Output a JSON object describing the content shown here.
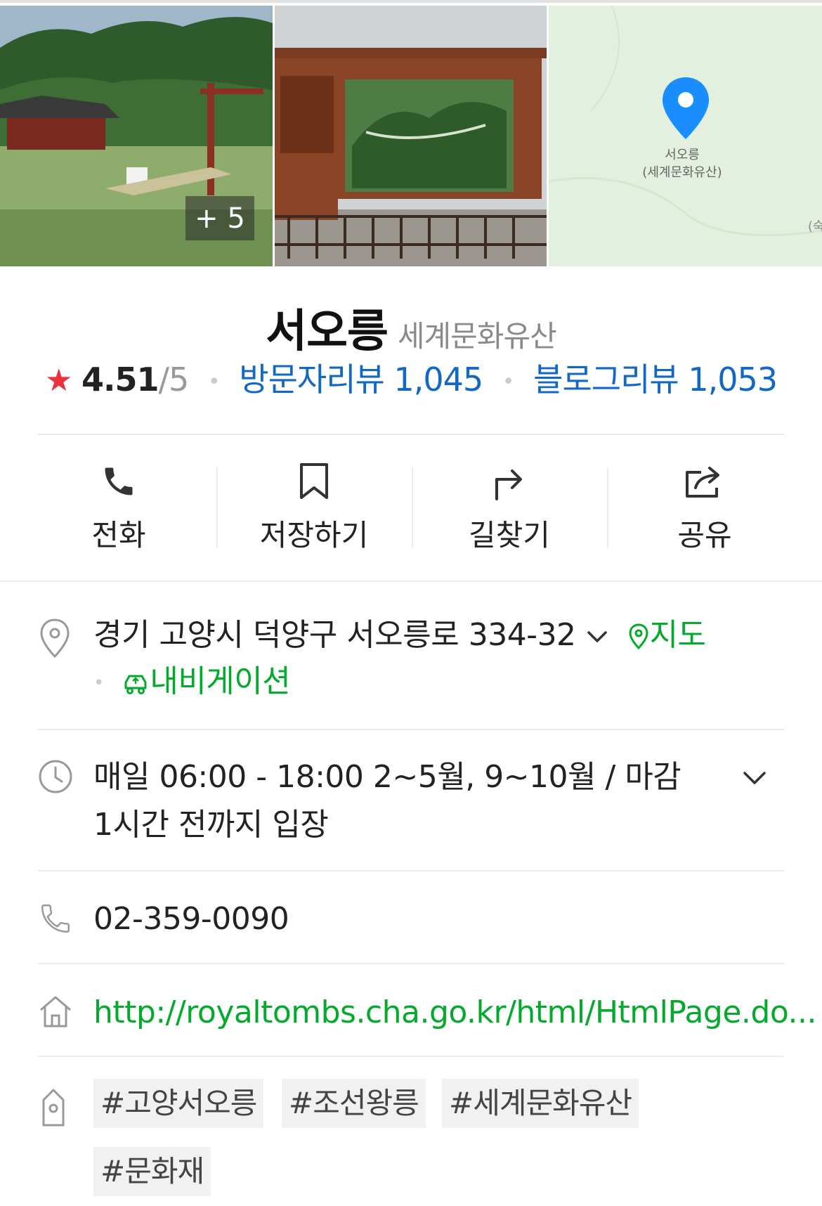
{
  "gallery": {
    "more_count": "+ 5",
    "map_pin_label_line1": "서오릉",
    "map_pin_label_line2": "(세계문화유산)",
    "map_edge_label": "(숙종"
  },
  "place": {
    "name": "서오릉",
    "category": "세계문화유산",
    "rating": "4.51",
    "rating_max": "/5",
    "visitor_reviews": "방문자리뷰 1,045",
    "blog_reviews": "블로그리뷰 1,053"
  },
  "actions": [
    {
      "label": "전화",
      "icon": "phone-icon"
    },
    {
      "label": "저장하기",
      "icon": "bookmark-icon"
    },
    {
      "label": "길찾기",
      "icon": "directions-icon"
    },
    {
      "label": "공유",
      "icon": "share-icon"
    }
  ],
  "info": {
    "address": "경기 고양시 덕양구 서오릉로 334-32",
    "map_link": "지도",
    "navigation_link": "내비게이션",
    "hours_line1": "매일 06:00 - 18:00 2~5월, 9~10월 / 마감",
    "hours_line2": "1시간 전까지 입장",
    "phone": "02-359-0090",
    "homepage": "http://royaltombs.cha.go.kr/html/HtmlPage.do...",
    "tags": [
      "#고양서오릉",
      "#조선왕릉",
      "#세계문화유산",
      "#문화재"
    ]
  },
  "colors": {
    "green_accent": "#03aa2c",
    "blue_link": "#1268c3",
    "star": "#e8323c",
    "map_pin": "#1a8dff"
  }
}
